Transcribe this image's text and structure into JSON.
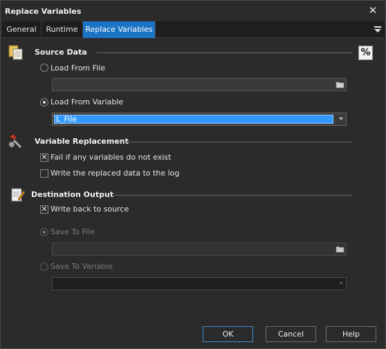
{
  "window": {
    "title": "Replace Variables"
  },
  "tabs": [
    {
      "label": "General"
    },
    {
      "label": "Runtime"
    },
    {
      "label": "Replace Variables"
    }
  ],
  "source_data": {
    "title": "Source Data",
    "percent_label": "%",
    "load_from_file": {
      "label": "Load From File",
      "checked": false,
      "value": ""
    },
    "load_from_variable": {
      "label": "Load From Variable",
      "checked": true,
      "selected": "L_File"
    }
  },
  "variable_replacement": {
    "title": "Variable Replacement",
    "fail_if_missing": {
      "label": "Fail if any variables do not exist",
      "checked": true
    },
    "write_to_log": {
      "label": "Write the replaced data to the log",
      "checked": false
    }
  },
  "destination_output": {
    "title": "Destination Output",
    "write_back": {
      "label": "Write back to source",
      "checked": true
    },
    "save_to_file": {
      "label": "Save To File",
      "checked": true,
      "disabled": true,
      "value": ""
    },
    "save_to_variable": {
      "label": "Save To Variable",
      "checked": false,
      "disabled": true,
      "value": ""
    }
  },
  "buttons": {
    "ok": "OK",
    "cancel": "Cancel",
    "help": "Help"
  },
  "colors": {
    "accent": "#1c74c4",
    "selection": "#3399ff",
    "background": "#2b2b2b"
  }
}
